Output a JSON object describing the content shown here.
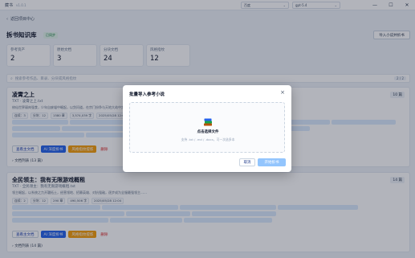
{
  "window": {
    "app_name": "藏书",
    "version": "v1.0.1",
    "select_one": "百度",
    "select_two": "gpt-5.4",
    "min_glyph": "—",
    "max_glyph": "☐",
    "close_glyph": "✕"
  },
  "header": {
    "back_label": "返回项目中心",
    "title": "拆书知识库",
    "tag": "已同步",
    "import_button": "导入小说并拆书"
  },
  "stats": [
    {
      "label": "参考资产",
      "value": "2"
    },
    {
      "label": "原始文档",
      "value": "3"
    },
    {
      "label": "分块文档",
      "value": "24"
    },
    {
      "label": "风格指纹",
      "value": "12"
    }
  ],
  "search": {
    "placeholder": "搜索参考作品、目录、分块或风格指纹",
    "count": "2 / 2"
  },
  "books": [
    {
      "title": "凌霄之上",
      "subtitle": "TXT · 凌霄之上.txt",
      "count": "10 篇",
      "description": "修仙世界弱肉强食，少年自废墟中崛起，以剑问道，在宗门纷争与天地大劫中步步登顶，书写属于自己的传说，情节节奏紧凑，伏笔层层推进，情感与战斗并重……",
      "metas": [
        "连续：3",
        "分块：12",
        "1580 章",
        "3,574,039 字",
        "2025/05/28 12:04"
      ],
      "actions": [
        "查看主文档",
        "AI 深度拆书",
        "风格指纹提炼",
        "删除"
      ],
      "files": "文档列表 (13 篇)"
    },
    {
      "title": "全民领主：我有无限游戏概租",
      "subtitle": "TXT · 全民领主：我有无限游戏概租.txt",
      "count": "14 篇",
      "description": "领主崛起，以系统之力开疆拓土，经营领地、招募英雄、对抗强敌，逐步成为全服最强领主……",
      "metas": [
        "连续：2",
        "分块：12",
        "290 章",
        "490,506 字",
        "2025/05/28 12:04"
      ],
      "actions": [
        "查看主文档",
        "AI 深度拆书",
        "风格指纹提炼",
        "删除"
      ],
      "files": "文档列表 (14 篇)"
    }
  ],
  "modal": {
    "title": "批量导入参考小说",
    "close": "×",
    "drop_main": "点击选择文件",
    "drop_hint": "支持 .txt / .md / .docx，可一次选多本",
    "cancel": "取消",
    "start": "开始拆书"
  },
  "colors": {
    "primary": "#2563eb",
    "accent_orange": "#f59e0b",
    "danger": "#dc2626",
    "overlay": "rgba(15,23,42,0.32)"
  }
}
